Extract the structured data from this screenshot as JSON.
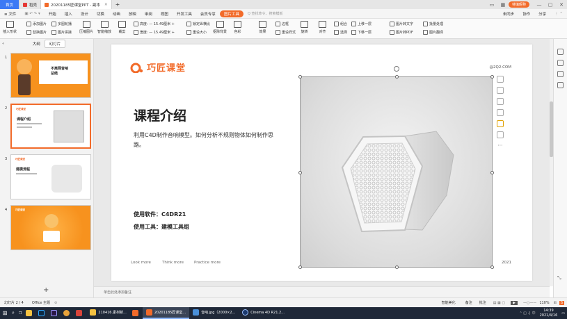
{
  "tabs": {
    "home": "首页",
    "t1": "稻壳",
    "t2": "20201185匠课堂PPT - 副本",
    "add": "+"
  },
  "window": {
    "account": "待填昵称",
    "minimize": "—",
    "maximize": "▢",
    "close": "✕"
  },
  "menu": {
    "file": "≡ 文件",
    "items": [
      "开始",
      "插入",
      "设计",
      "切换",
      "动画",
      "放映",
      "审阅",
      "视图",
      "开发工具",
      "会员专享"
    ],
    "active": "图片工具",
    "search": "Q 查找命令、搜索模板",
    "sync": "未同步",
    "collab": "协作",
    "share": "分享"
  },
  "ribbon": {
    "insert_img": "插入形状",
    "add_img": "添加图片",
    "replace_img": "替换图片",
    "multi_img": "多图轮播",
    "img_combine": "图片拼接",
    "compress": "压缩图片",
    "smart_pic": "智能缩放",
    "crop": "裁剪",
    "height": "高度: — 15.49厘米 +",
    "width": "宽度: — 15.49厘米 +",
    "lock": "锁定纵横比",
    "reset_size": "重设大小",
    "remove_bg": "抠除背景",
    "color": "色彩",
    "effect": "效果",
    "border": "边框",
    "reset_style": "重设样式",
    "rotate": "旋转",
    "align": "对齐",
    "group": "组合",
    "up": "上移一层",
    "down": "下移一层",
    "select": "选择",
    "to_text": "图片转文字",
    "to_pdf": "图片转PDF",
    "batch": "批量处理",
    "translate": "图片翻译"
  },
  "panel": {
    "outline": "大纲",
    "slides": "幻灯片",
    "nums": [
      "1",
      "2",
      "3",
      "4"
    ],
    "add": "+",
    "s1_title": "不离网音响",
    "s1_sub": "总结",
    "s2_title": "课程介绍",
    "s3_title": "建模流程",
    "mini_logo": "巧匠课堂"
  },
  "slide": {
    "logo": "巧匠课堂",
    "qq": "@2Q2.COM",
    "title": "课程介绍",
    "desc": "利用C4D制作音响模型。如何分析不规则物体如何制作思路。",
    "software": "使用软件：C4DR21",
    "tools": "使用工具：建模工具组",
    "foot1": "Look more",
    "foot2": "Think more",
    "foot3": "Practice more",
    "year": "2021"
  },
  "notes": "单击此处添加备注",
  "status": {
    "slide_no": "幻灯片 2 / 4",
    "theme": "Office 主题",
    "beautify": "智能美化",
    "notes": "备注",
    "comment": "批注",
    "zoom": "110%"
  },
  "taskbar": {
    "search": "⌕",
    "app1": "210416.素材新...",
    "app2": "20201185匠课堂...",
    "app3": "音响.jpg（2000×2...",
    "app4": "Cinema 4D R21.2...",
    "time": "14:39",
    "date": "2021/4/16"
  },
  "colors": {
    "accent": "#f26b2a",
    "home_tab": "#3d7af5",
    "taskbar": "#1f2838"
  }
}
